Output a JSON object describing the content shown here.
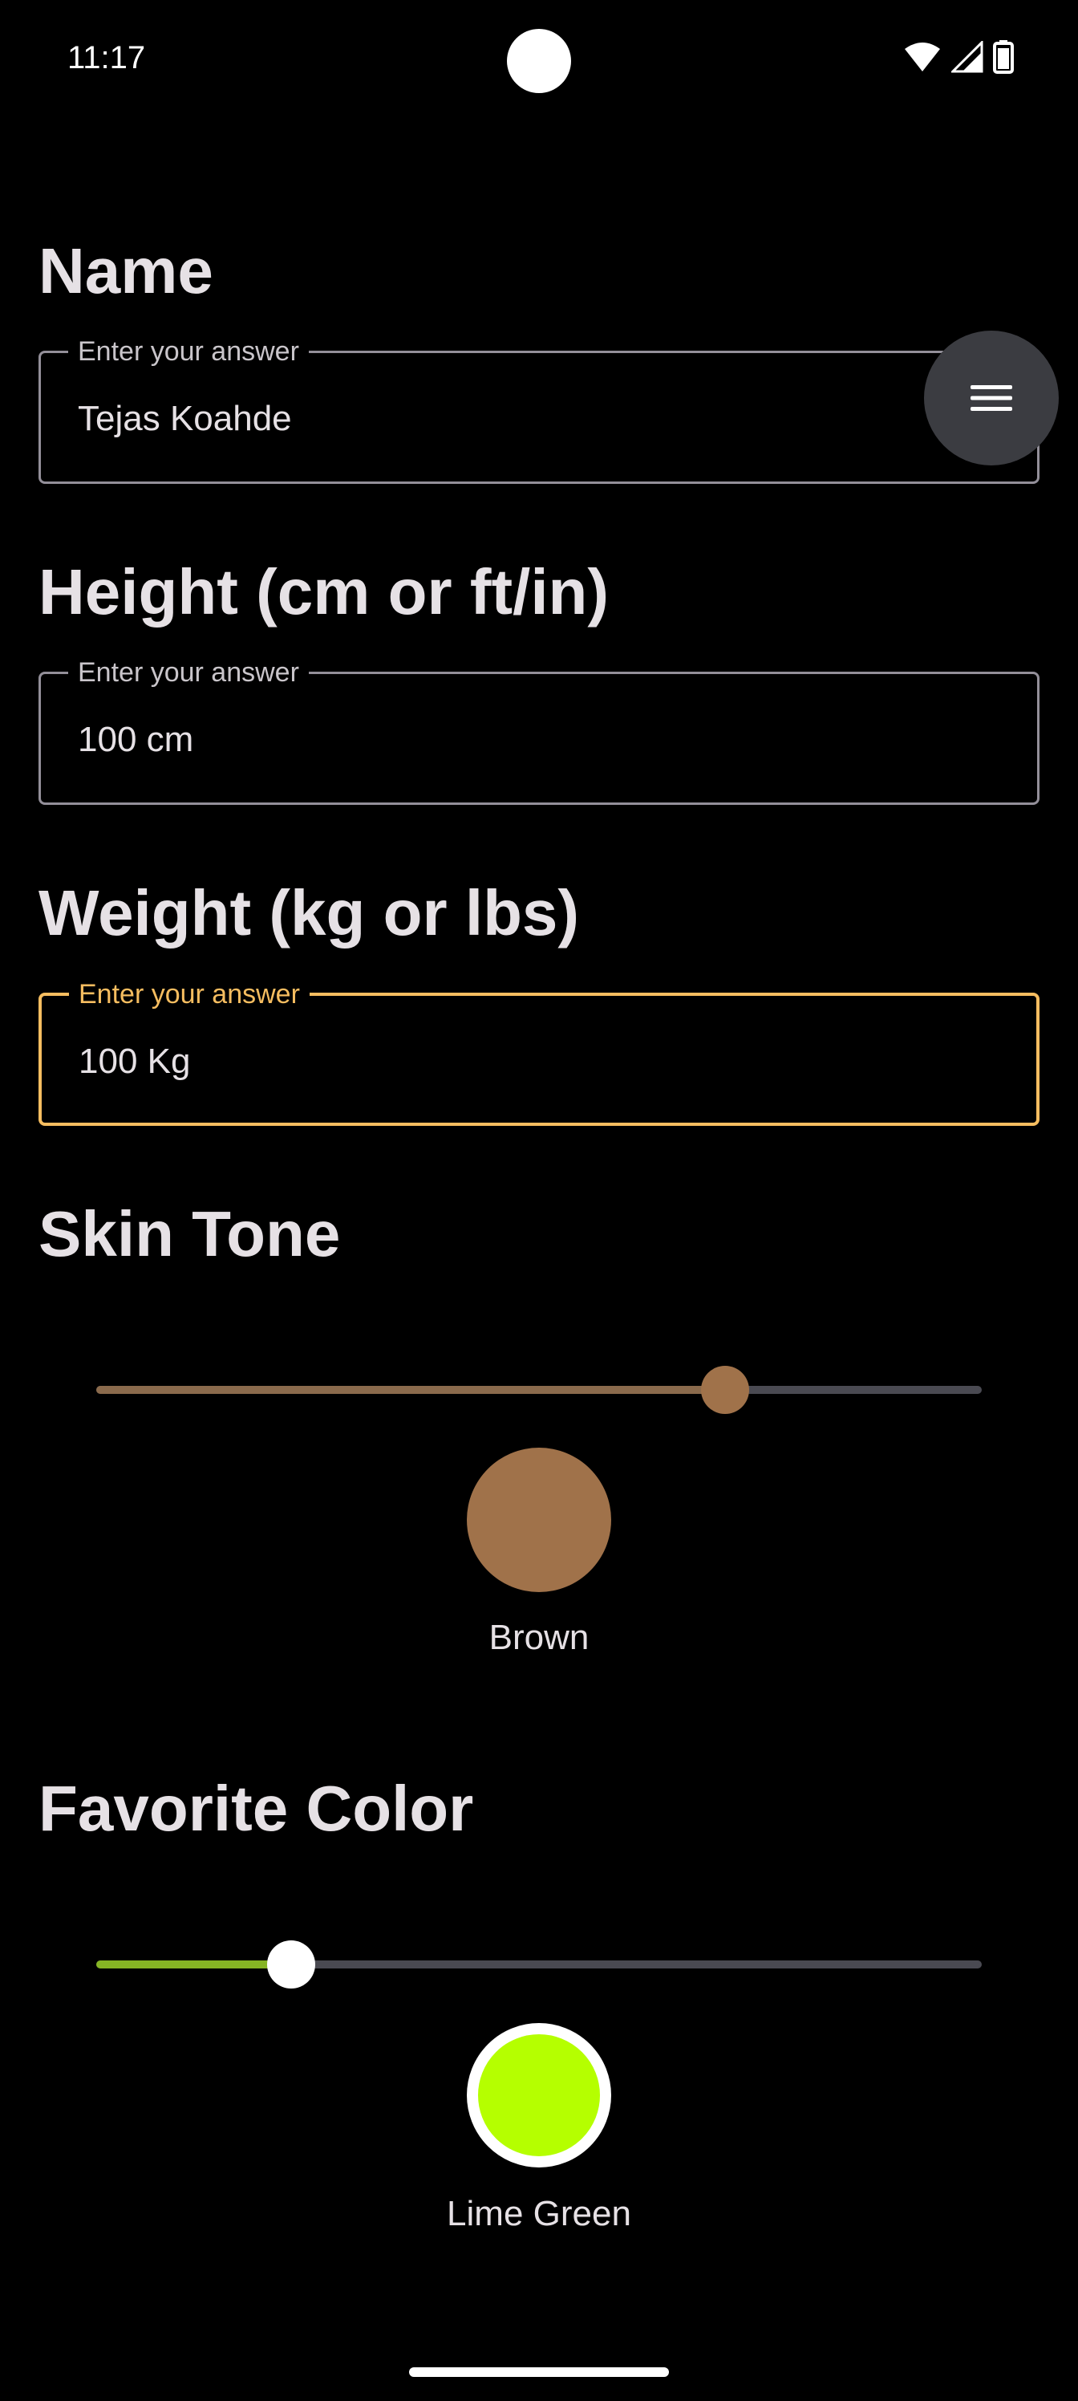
{
  "status_bar": {
    "time": "11:17",
    "icons": [
      "wifi-icon",
      "cell-signal-icon",
      "battery-icon"
    ]
  },
  "menu_button": {
    "icon": "menu-icon"
  },
  "form": {
    "name": {
      "title": "Name",
      "label": "Enter your answer",
      "value": "Tejas Koahde"
    },
    "height": {
      "title": "Height (cm or ft/in)",
      "label": "Enter your answer",
      "value": "100 cm"
    },
    "weight": {
      "title": "Weight (kg or lbs)",
      "label": "Enter your answer",
      "value": "100 Kg",
      "focused": true
    },
    "skin_tone": {
      "title": "Skin Tone",
      "slider_value": 0.71,
      "selected_label": "Brown",
      "selected_color": "#a0724a"
    },
    "favorite_color": {
      "title": "Favorite Color",
      "slider_value": 0.22,
      "selected_label": "Lime Green",
      "selected_color": "#b5ff00"
    }
  },
  "colors": {
    "background": "#000000",
    "accent_focus": "#f6bd60",
    "outline": "#938f99",
    "slider_inactive": "#4a4a52",
    "skin_fill": "#8a6a4c",
    "favorite_fill": "#86b524",
    "fab_background": "#3b3c41"
  }
}
